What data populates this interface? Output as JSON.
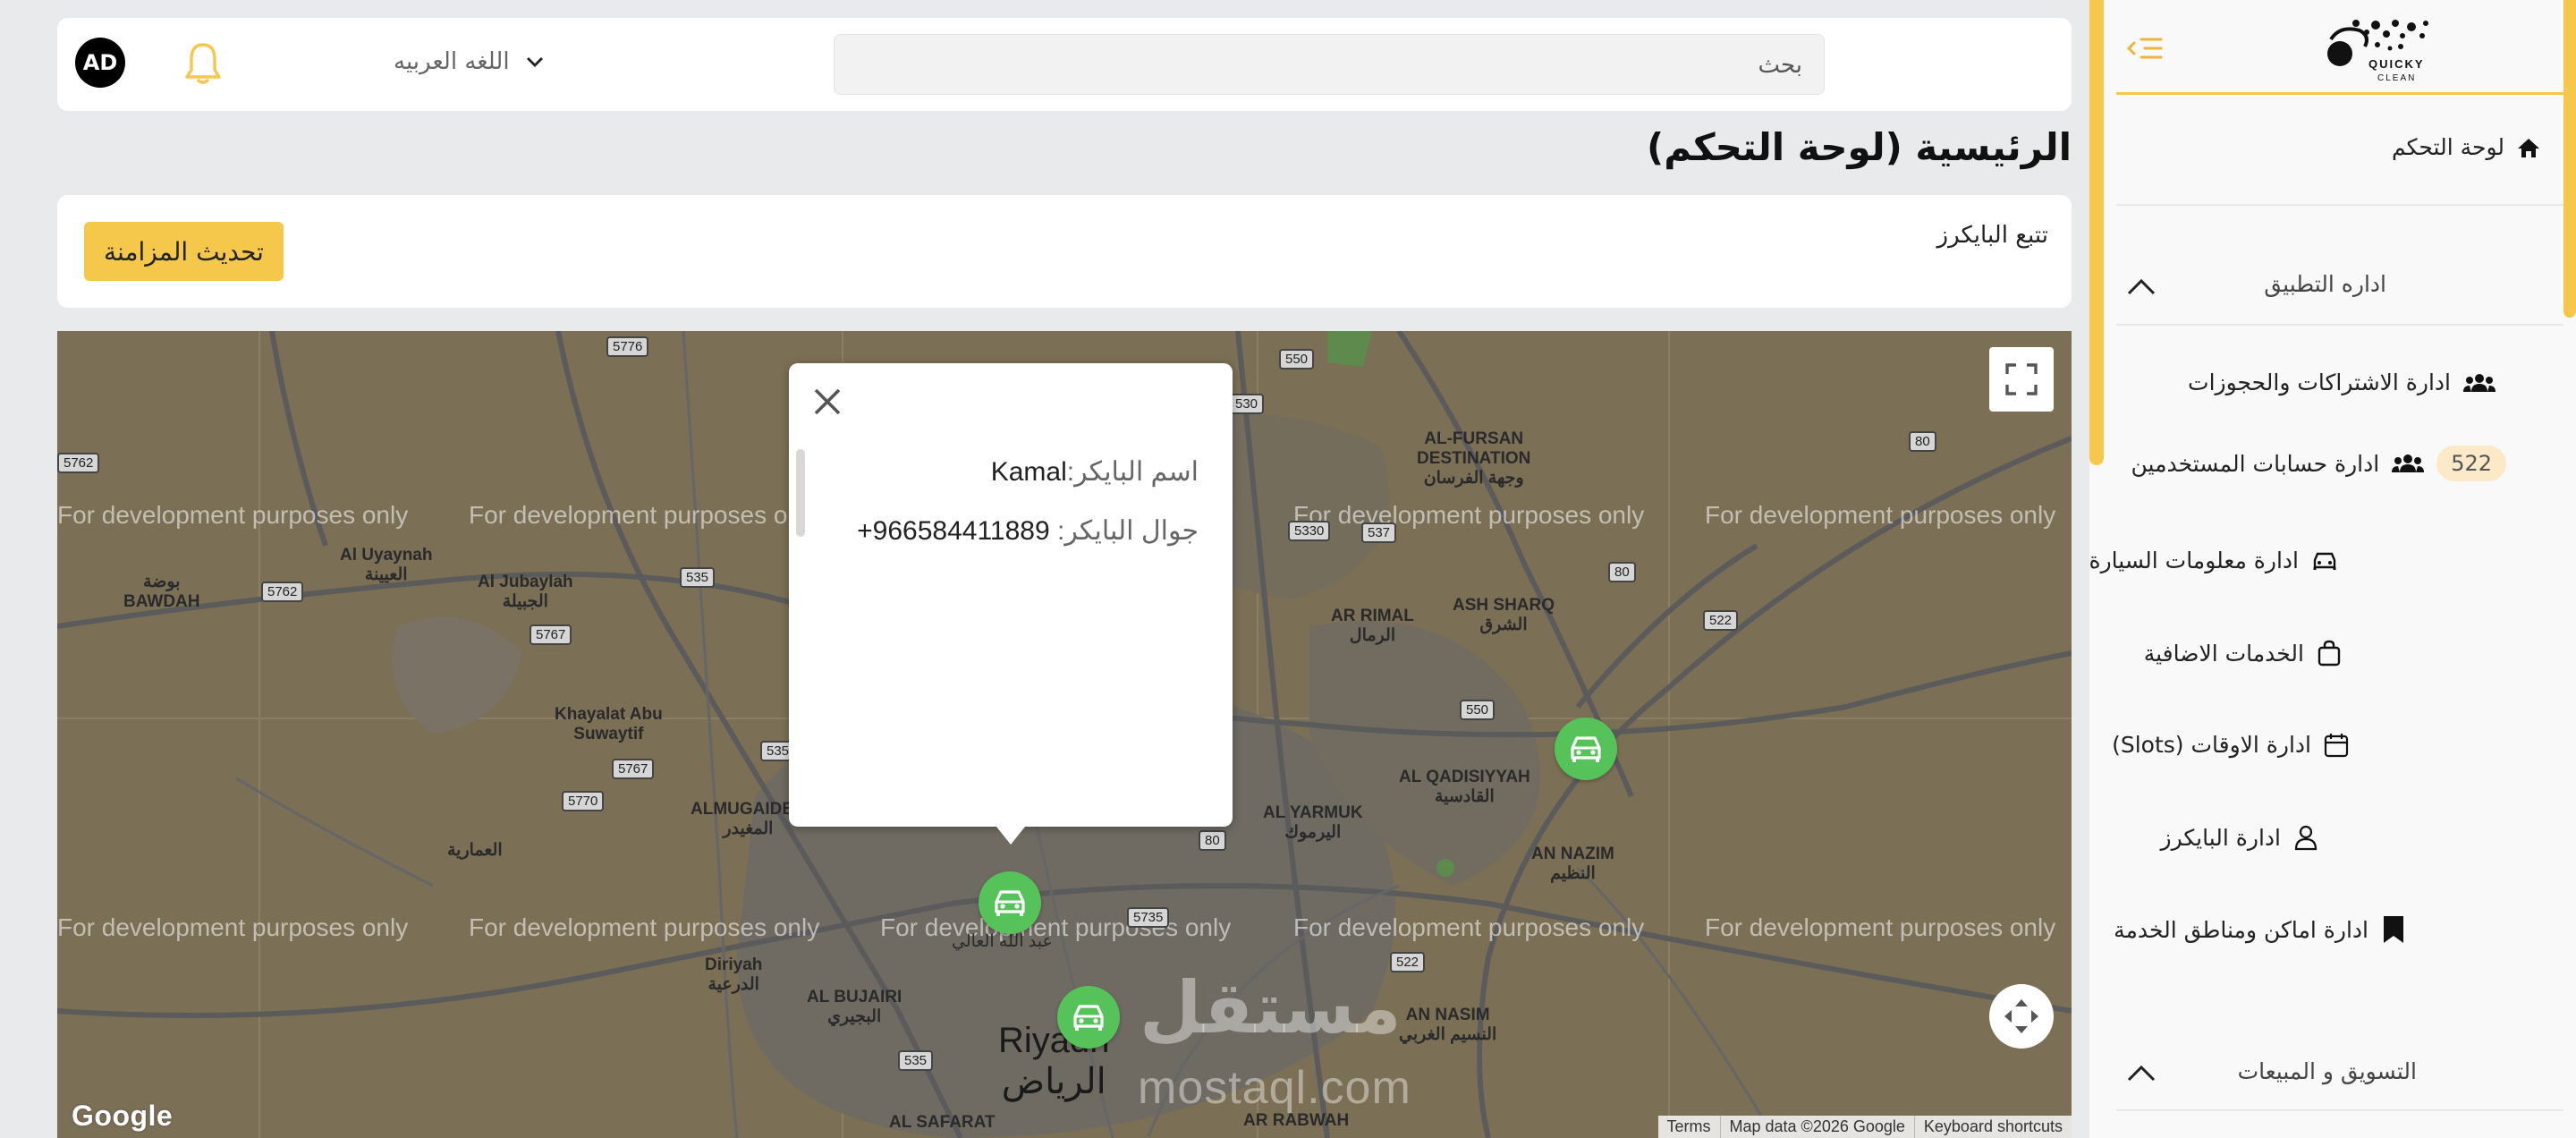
{
  "header": {
    "avatar_initials": "AD",
    "language_label": "اللغه العربيه",
    "search_placeholder": "بحث"
  },
  "page": {
    "title": "الرئيسية (لوحة التحكم)"
  },
  "tracking": {
    "title": "تتبع البايكرز",
    "sync_button": "تحديث المزامنة"
  },
  "sidebar": {
    "brand": "QUICKY CLEAN",
    "dashboard": "لوحة التحكم",
    "section_app": "اداره التطبيق",
    "items": [
      {
        "label": "ادارة الاشتراكات والحجوزات",
        "icon": "users-icon"
      },
      {
        "label": "ادارة حسابات المستخدمين",
        "icon": "users-icon",
        "badge": "522"
      },
      {
        "label": "ادارة معلومات السيارة",
        "icon": "car-icon"
      },
      {
        "label": "الخدمات الاضافية",
        "icon": "bag-icon"
      },
      {
        "label": "ادارة الاوقات (Slots)",
        "icon": "calendar-icon"
      },
      {
        "label": "ادارة البايكرز",
        "icon": "user-icon"
      },
      {
        "label": "ادارة اماكن ومناطق الخدمة",
        "icon": "bookmark-icon"
      }
    ],
    "section_marketing": "التسويق و المبيعات"
  },
  "map": {
    "dev_watermark": "For development purposes only",
    "places": {
      "riyadh_en": "Riyadh",
      "riyadh_ar": "الرياض",
      "al_fursan_en": "AL-FURSAN",
      "destination_en": "DESTINATION",
      "al_fursan_ar": "وجهة الفرسان",
      "ash_sharq_en": "ASH SHARQ",
      "ash_sharq_ar": "الشرق",
      "ar_rimal_en": "AR RIMAL",
      "ar_rimal_ar": "الرمال",
      "al_qadisiyyah_en": "AL QADISIYYAH",
      "al_qadisiyyah_ar": "القادسية",
      "al_yarmuk_en": "AL YARMUK",
      "al_yarmuk_ar": "اليرموك",
      "an_nazim_en": "AN NAZIM",
      "an_nazim_ar": "النظيم",
      "al_uyaynah_en": "Al Uyaynah",
      "al_uyaynah_ar": "العيينة",
      "al_jubaylah_en": "Al Jubaylah",
      "al_jubaylah_ar": "الجبيلة",
      "bawdah_ar": "بوضة",
      "bawdah_en": "BAWDAH",
      "khayalat_1": "Khayalat Abu",
      "khayalat_2": "Suwaytif",
      "almugaider_en": "ALMUGAIDER",
      "almugaider_ar": "المغيدر",
      "al_ammariyah_ar": "العمارية",
      "diriyah_en": "Diriyah",
      "diriyah_ar": "الدرعية",
      "al_bujairi_en": "AL BUJAIRI",
      "al_bujairi_ar": "البجيري",
      "an_nasim_en": "AN NASIM",
      "an_nasim_ar": "النسيم الغربي",
      "abdullah_ar": "عبد الله العالي",
      "al_safarat": "AL SAFARAT",
      "ar_rabwah": "AR RABWAH"
    },
    "routes": [
      "5776",
      "550",
      "5762",
      "530",
      "80",
      "5762",
      "535",
      "5767",
      "5330",
      "537",
      "522",
      "550",
      "5767",
      "5770",
      "535",
      "80",
      "5735",
      "522",
      "80",
      "535"
    ],
    "info_window": {
      "name_label": "اسم البايكر:",
      "name_value": "Kamal",
      "phone_label": "جوال البايكر:",
      "phone_value": "+966584411889"
    },
    "google_logo": "Google",
    "attribution": [
      "Keyboard shortcuts",
      "Map data ©2026 Google",
      "Terms"
    ]
  },
  "watermark": {
    "logo": "مستقل",
    "url": "mostaql.com"
  }
}
